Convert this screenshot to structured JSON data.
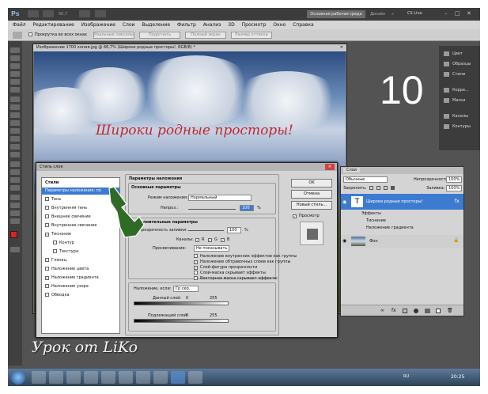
{
  "app": {
    "logo": "Ps",
    "zoom": "66,7",
    "workspace": "Основная рабочая среда",
    "design": "Дизайн",
    "cslive": "CS Live"
  },
  "menu": [
    "Файл",
    "Редактирование",
    "Изображение",
    "Слои",
    "Выделение",
    "Фильтр",
    "Анализ",
    "3D",
    "Просмотр",
    "Окно",
    "Справка"
  ],
  "options": {
    "scroll_all": "Прокрутка во всех окнах",
    "buttons": [
      "Реальные пикселы",
      "Подогнать",
      "Полный экран",
      "Размер оттиска"
    ]
  },
  "document": {
    "title": "Изображение 1700 копия.jpg @ 66,7% (Широки родные просторы!, RGB/8) *",
    "headline": "Широки родные просторы!"
  },
  "overlay": {
    "number": "10",
    "signature": "Урок от LiKo"
  },
  "right_panels": [
    "Цвет",
    "Образцы",
    "Стили",
    "Корре...",
    "Маски",
    "Каналы",
    "Контуры"
  ],
  "layers": {
    "tabs": [
      "Слои"
    ],
    "blend_mode": "Обычные",
    "opacity_label": "Непрозрачность:",
    "opacity": "100%",
    "lock_label": "Закрепить:",
    "fill_label": "Заливка:",
    "fill": "100%",
    "text_layer": "Широки родные просторы!",
    "effects_label": "Эффекты",
    "effect1": "Тиснение",
    "effect2": "Наложение градиента",
    "bg_layer": "Фон"
  },
  "dialog": {
    "title": "Стиль слоя",
    "styles_header": "Стили",
    "items": [
      {
        "label": "Параметры наложения: по умолчанию",
        "checked": "",
        "selected": true
      },
      {
        "label": "Тень",
        "checked": ""
      },
      {
        "label": "Внутренняя тень",
        "checked": ""
      },
      {
        "label": "Внешнее свечение",
        "checked": ""
      },
      {
        "label": "Внутреннее свечение",
        "checked": ""
      },
      {
        "label": "Тиснение",
        "checked": "✓"
      },
      {
        "label": "Контур",
        "checked": ""
      },
      {
        "label": "Текстура",
        "checked": ""
      },
      {
        "label": "Глянец",
        "checked": ""
      },
      {
        "label": "Наложение цвета",
        "checked": ""
      },
      {
        "label": "Наложение градиента",
        "checked": "✓"
      },
      {
        "label": "Наложение узора",
        "checked": ""
      },
      {
        "label": "Обводка",
        "checked": ""
      }
    ],
    "blending_title": "Параметры наложения",
    "basic_title": "Основные параметры",
    "blend_mode_label": "Режим наложения:",
    "blend_mode_value": "Нормальный",
    "opacity_label": "Непроз.:",
    "opacity_value": "100",
    "percent": "%",
    "advanced_title": "Дополнительные параметры",
    "fill_opacity_label": "Непрозрачность заливки:",
    "fill_opacity_value": "100",
    "channels_label": "Каналы:",
    "ch_r": "R",
    "ch_g": "G",
    "ch_b": "B",
    "knockout_label": "Просвечивание:",
    "knockout_value": "Не показывать",
    "adv_checks": [
      {
        "label": "Наложение внутренних эффектов как группы",
        "checked": ""
      },
      {
        "label": "Наложение обтравочных слоев как группы",
        "checked": "✓"
      },
      {
        "label": "Слой-фигура прозрачности",
        "checked": "✓"
      },
      {
        "label": "Слой-маска скрывает эффекты",
        "checked": ""
      },
      {
        "label": "Векторная маска скрывает эффекты",
        "checked": ""
      }
    ],
    "blendif_label": "Наложение, если:",
    "blendif_value": "Гр.сер.",
    "this_layer_label": "Данный слой:",
    "this_min": "0",
    "this_max": "255",
    "under_layer_label": "Подлежащий слой:",
    "under_min": "0",
    "under_max": "255",
    "ok": "OK",
    "cancel": "Отмена",
    "new_style": "Новый стиль...",
    "preview": "Просмотр"
  },
  "taskbar": {
    "lang": "RU",
    "time": "20:25"
  }
}
